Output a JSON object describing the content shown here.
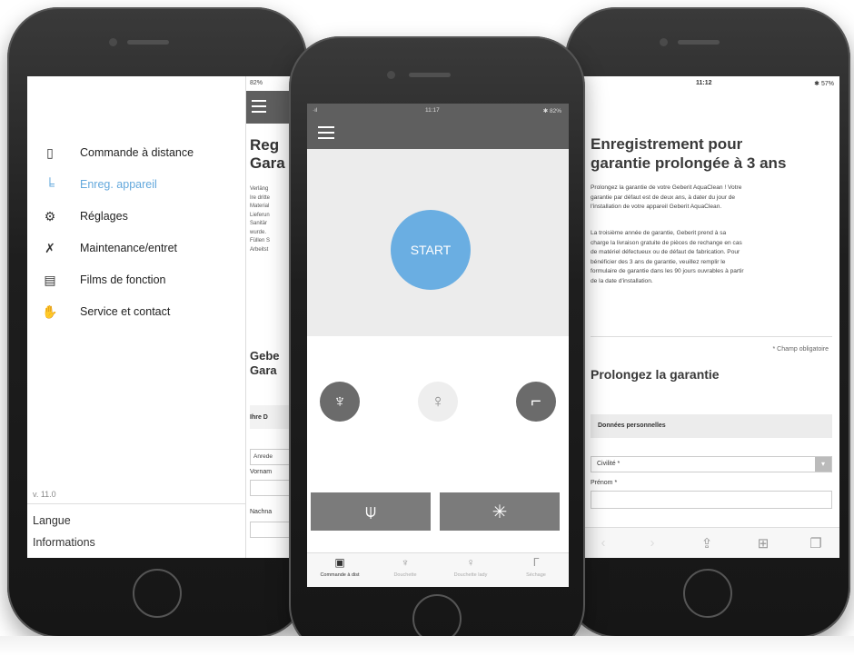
{
  "left_phone": {
    "status": "82%",
    "menu": [
      {
        "label": "Commande à distance",
        "icon": "remote-icon",
        "active": false
      },
      {
        "label": "Enreg. appareil",
        "icon": "toilet-icon",
        "active": true
      },
      {
        "label": "Réglages",
        "icon": "gear-icon",
        "active": false
      },
      {
        "label": "Maintenance/entret",
        "icon": "tools-icon",
        "active": false
      },
      {
        "label": "Films de fonction",
        "icon": "film-icon",
        "active": false
      },
      {
        "label": "Service et contact",
        "icon": "handshake-icon",
        "active": false
      }
    ],
    "version": "v. 11.0",
    "language_link": "Langue",
    "info_link": "Informations",
    "peek": {
      "title": "Reg\nGara",
      "text": "Verläng\nIre dritte\nMaterial\nLieferun\nSanitär\nwurde.\nFüllen S\nArbeitst",
      "title2": "Gebe\nGara",
      "section": "Ihre D",
      "select": "Anrede",
      "label1": "Vornam",
      "label2": "Nachna"
    }
  },
  "middle_phone": {
    "status_left": "·ıl",
    "status_center": "11:17",
    "status_right": "✱ 82%",
    "start_label": "START",
    "modes": [
      {
        "icon": "spray-icon",
        "style": "dark"
      },
      {
        "icon": "person-icon",
        "style": "light"
      },
      {
        "icon": "dryer-icon",
        "style": "dark"
      }
    ],
    "tiles": [
      {
        "icon": "nozzle-icon",
        "glyph": "⍦"
      },
      {
        "icon": "fan-icon",
        "glyph": "✳"
      }
    ],
    "tabs": [
      {
        "label": "Commande à dist",
        "icon": "remote-icon",
        "glyph": "▣",
        "active": true
      },
      {
        "label": "Douchette",
        "icon": "spray-icon",
        "glyph": "♆",
        "active": false
      },
      {
        "label": "Douchette lady",
        "icon": "person-icon",
        "glyph": "♀",
        "active": false
      },
      {
        "label": "Séchage",
        "icon": "dryer-icon",
        "glyph": "ᒥ",
        "active": false
      }
    ]
  },
  "right_phone": {
    "status_time": "11:12",
    "status_right": "✱ 57%",
    "title": "Enregistrement pour\ngarantie prolongée à 3 ans",
    "para1": "Prolongez la garantie de votre Geberit AquaClean ! Votre\ngarantie par défaut est de deux ans, à dater du jour de\nl'installation de votre appareil Geberit AquaClean.",
    "para2": "La troisième année de garantie, Geberit prend à sa\ncharge la livraison gratuite de pièces de rechange en cas\nde matériel défectueux ou de défaut de fabrication. Pour\nbénéficier des 3 ans de garantie, veuillez remplir le\nformulaire de garantie dans les 90 jours ouvrables à partir\nde la date d'installation.",
    "required_note": "* Champ obligatoire",
    "form_title": "Prolongez la garantie",
    "section_title": "Données personnelles",
    "civility_select": "Civilité *",
    "first_name_label": "Prénom *",
    "toolbar": [
      {
        "icon": "back-arrow-icon",
        "glyph": "‹",
        "dim": true
      },
      {
        "icon": "forward-arrow-icon",
        "glyph": "›",
        "dim": true
      },
      {
        "icon": "share-icon",
        "glyph": "⇪",
        "dim": false
      },
      {
        "icon": "bookmarks-icon",
        "glyph": "⊞",
        "dim": false
      },
      {
        "icon": "tabs-icon",
        "glyph": "❐",
        "dim": false
      }
    ]
  }
}
